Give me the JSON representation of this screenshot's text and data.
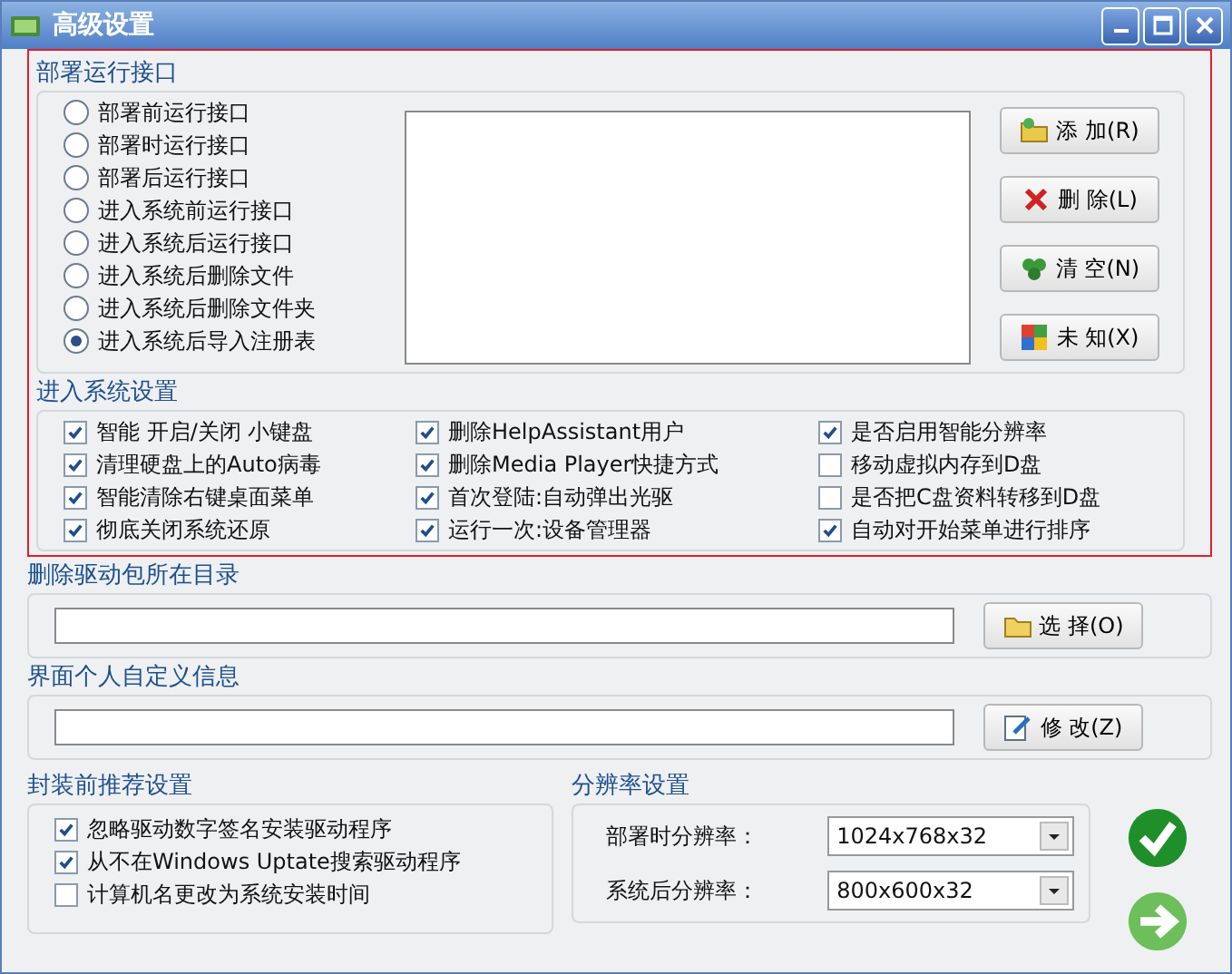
{
  "window": {
    "title": "高级设置"
  },
  "deploy_interface": {
    "title": "部署运行接口",
    "options": [
      {
        "label": "部署前运行接口",
        "selected": false
      },
      {
        "label": "部署时运行接口",
        "selected": false
      },
      {
        "label": "部署后运行接口",
        "selected": false
      },
      {
        "label": "进入系统前运行接口",
        "selected": false
      },
      {
        "label": "进入系统后运行接口",
        "selected": false
      },
      {
        "label": "进入系统后删除文件",
        "selected": false
      },
      {
        "label": "进入系统后删除文件夹",
        "selected": false
      },
      {
        "label": "进入系统后导入注册表",
        "selected": true
      }
    ],
    "buttons": [
      {
        "kind": "add",
        "label": "添 加(R)"
      },
      {
        "kind": "delete",
        "label": "删 除(L)"
      },
      {
        "kind": "clear",
        "label": "清 空(N)"
      },
      {
        "kind": "unknown",
        "label": "未 知(X)"
      }
    ]
  },
  "system_settings": {
    "title": "进入系统设置",
    "items": [
      {
        "label": "智能 开启/关闭 小键盘",
        "checked": true
      },
      {
        "label": "清理硬盘上的Auto病毒",
        "checked": true
      },
      {
        "label": "智能清除右键桌面菜单",
        "checked": true
      },
      {
        "label": "彻底关闭系统还原",
        "checked": true
      },
      {
        "label": "删除HelpAssistant用户",
        "checked": true
      },
      {
        "label": "删除Media Player快捷方式",
        "checked": true
      },
      {
        "label": "首次登陆:自动弹出光驱",
        "checked": true
      },
      {
        "label": "运行一次:设备管理器",
        "checked": true
      },
      {
        "label": "是否启用智能分辨率",
        "checked": true
      },
      {
        "label": "移动虚拟内存到D盘",
        "checked": false
      },
      {
        "label": "是否把C盘资料转移到D盘",
        "checked": false
      },
      {
        "label": "自动对开始菜单进行排序",
        "checked": true
      }
    ]
  },
  "driver_dir": {
    "title": "删除驱动包所在目录",
    "button": {
      "label": "选 择(O)"
    }
  },
  "custom_info": {
    "title": "界面个人自定义信息",
    "button": {
      "label": "修 改(Z)"
    }
  },
  "pre_package": {
    "title": "封装前推荐设置",
    "items": [
      {
        "label": "忽略驱动数字签名安装驱动程序",
        "checked": true
      },
      {
        "label": "从不在Windows Uptate搜索驱动程序",
        "checked": true
      },
      {
        "label": "计算机名更改为系统安装时间",
        "checked": false
      }
    ]
  },
  "resolution": {
    "title": "分辨率设置",
    "rows": [
      {
        "label": "部署时分辨率：",
        "value": "1024x768x32"
      },
      {
        "label": "系统后分辨率：",
        "value": "800x600x32"
      }
    ]
  }
}
